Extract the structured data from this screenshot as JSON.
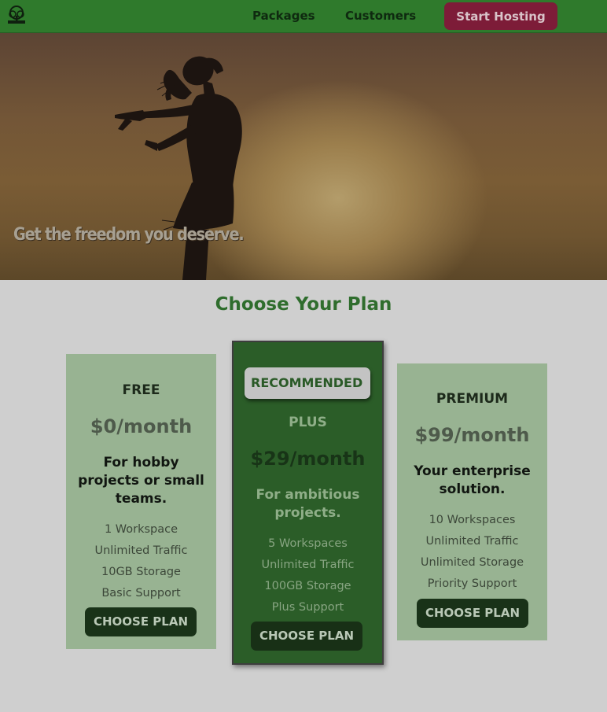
{
  "header": {
    "logo_icon": "tree-icon",
    "nav": [
      "Packages",
      "Customers"
    ],
    "cta_label": "Start Hosting"
  },
  "hero": {
    "tagline": "Get the freedom you deserve."
  },
  "pricing": {
    "title": "Choose Your Plan",
    "plans": [
      {
        "name": "FREE",
        "price": "$0/month",
        "description": "For hobby projects or small teams.",
        "features": [
          "1 Workspace",
          "Unlimited Traffic",
          "10GB Storage",
          "Basic Support"
        ],
        "button": "CHOOSE PLAN"
      },
      {
        "badge": "RECOMMENDED",
        "name": "PLUS",
        "price": "$29/month",
        "description": "For ambitious projects.",
        "features": [
          "5 Workspaces",
          "Unlimited Traffic",
          "100GB Storage",
          "Plus Support"
        ],
        "button": "CHOOSE PLAN"
      },
      {
        "name": "PREMIUM",
        "price": "$99/month",
        "description": "Your enterprise solution.",
        "features": [
          "10 Workspaces",
          "Unlimited Traffic",
          "Unlimited Storage",
          "Priority Support"
        ],
        "button": "CHOOSE PLAN"
      }
    ]
  },
  "colors": {
    "header_bg": "#2f7a2c",
    "cta_bg": "#7d1c38",
    "accent_green": "#2f6d2d",
    "recommended_card_bg": "#2b5d28",
    "card_bg": "#98b392",
    "button_bg": "#193218"
  }
}
